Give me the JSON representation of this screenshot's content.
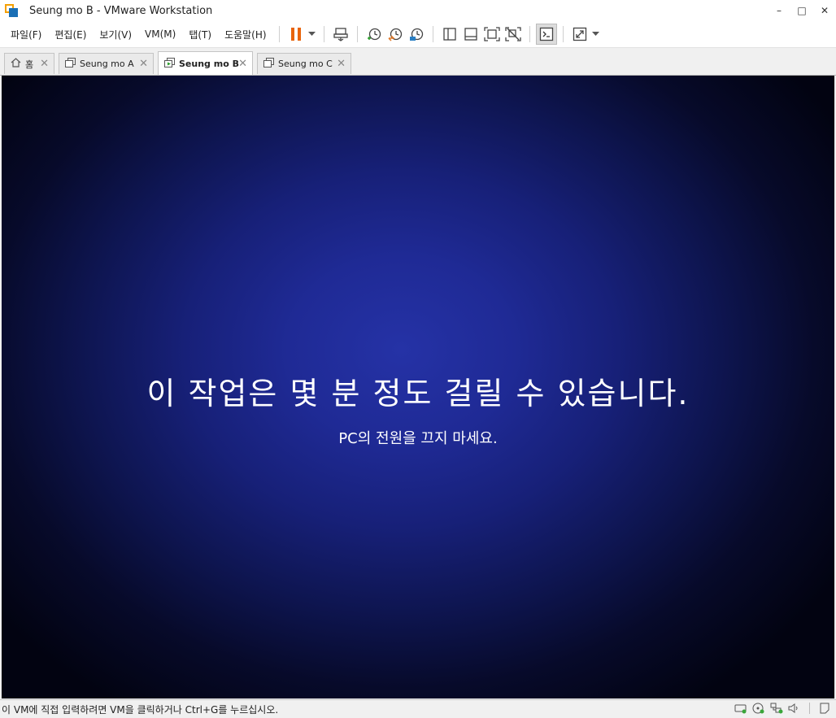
{
  "window": {
    "title": "Seung mo B - VMware Workstation"
  },
  "window_controls": {
    "minimize": "–",
    "maximize": "□",
    "close": "✕"
  },
  "menu": [
    "파일(F)",
    "편집(E)",
    "보기(V)",
    "VM(M)",
    "탭(T)",
    "도움말(H)"
  ],
  "toolbar": {
    "icons": [
      "pause-icon",
      "dropdown-arrow-icon",
      "send-ctrl-alt-del-icon",
      "snapshot-take-icon",
      "snapshot-revert-icon",
      "snapshot-manager-icon",
      "library-view-icon",
      "thumbnail-bar-icon",
      "fullscreen-icon",
      "unity-icon",
      "console-view-icon",
      "stretch-view-icon",
      "dropdown-arrow-icon"
    ],
    "accent_pause": "#e8630a"
  },
  "tabs": [
    {
      "label": "홈",
      "icon": "home-icon",
      "active": false
    },
    {
      "label": "Seung mo A",
      "icon": "vm-tab-icon",
      "active": false
    },
    {
      "label": "Seung mo B",
      "icon": "vm-running-icon",
      "active": true
    },
    {
      "label": "Seung mo C",
      "icon": "vm-tab-icon",
      "active": false
    }
  ],
  "tab_close_glyph": "✕",
  "vm_screen": {
    "main_text": "이 작업은 몇 분 정도 걸릴 수 있습니다.",
    "sub_text": "PC의 전원을 끄지 마세요.",
    "background_center": "#2532a6",
    "background_edge": "#020311"
  },
  "status_bar": {
    "message": "이 VM에 직접 입력하려면 VM을 클릭하거나 Ctrl+G를 누르십시오.",
    "icons": [
      "hard-disk-icon",
      "cd-dvd-icon",
      "network-adapter-icon",
      "sound-card-icon",
      "message-log-icon"
    ]
  }
}
